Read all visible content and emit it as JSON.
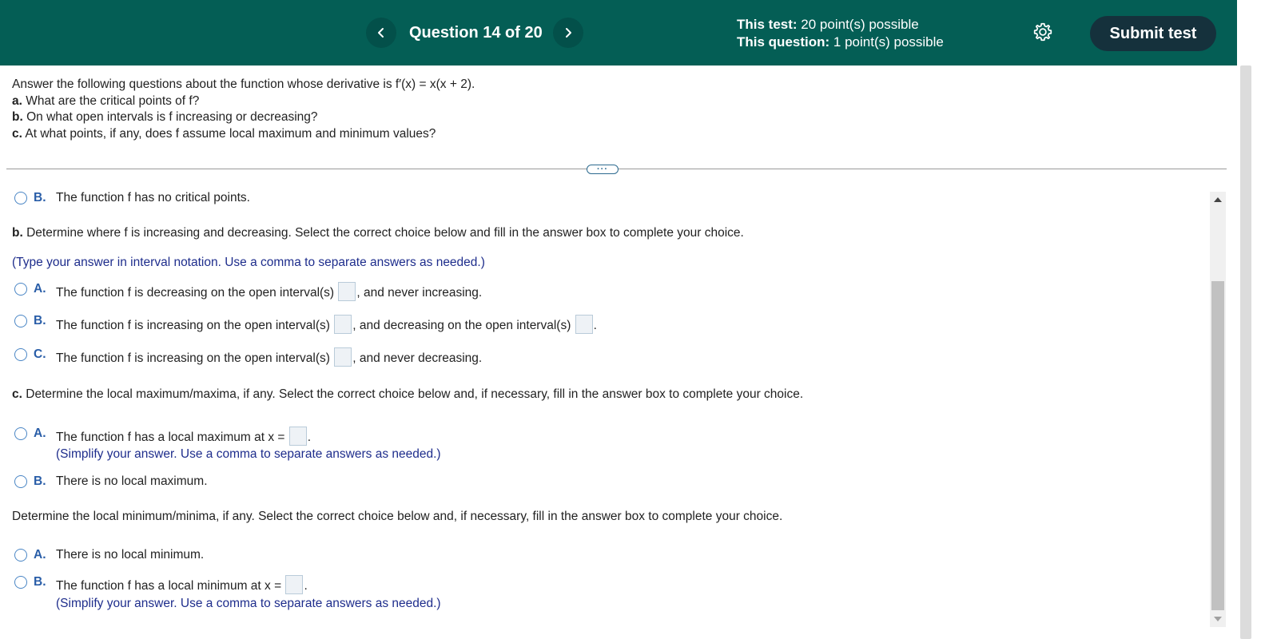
{
  "header": {
    "question_label": "Question 14 of 20",
    "test_points_label": "This test:",
    "test_points_value": "20 point(s) possible",
    "question_points_label": "This question:",
    "question_points_value": "1 point(s) possible",
    "submit_label": "Submit test",
    "background_color": "#045e55"
  },
  "prompt": {
    "line0": "Answer the following questions about the function whose derivative is f′(x) = x(x + 2).",
    "a_prefix": "a.",
    "a_text": " What are the critical points of f?",
    "b_prefix": "b.",
    "b_text": " On what open intervals is f increasing or decreasing?",
    "c_prefix": "c.",
    "c_text": " At what points, if any, does f assume local maximum and minimum values?"
  },
  "expand_button": "···",
  "part_a": {
    "option_b_letter": "B.",
    "option_b_text": "The function f has no critical points."
  },
  "part_b": {
    "prefix": "b.",
    "instruction": " Determine where f is increasing and decreasing. Select the correct choice below and fill in the answer box to complete your choice.",
    "hint": "(Type your answer in interval notation. Use a comma to separate answers as needed.)",
    "option_a_letter": "A.",
    "option_a_pre": "The function f is decreasing on the open interval(s) ",
    "option_a_post": ", and never increasing.",
    "option_b_letter": "B.",
    "option_b_pre": "The function f is increasing on the open interval(s) ",
    "option_b_mid": ", and decreasing on the open interval(s) ",
    "option_b_post": ".",
    "option_c_letter": "C.",
    "option_c_pre": "The function f is increasing on the open interval(s) ",
    "option_c_post": ", and never decreasing."
  },
  "part_c": {
    "prefix": "c.",
    "instruction": " Determine the local maximum/maxima, if any. Select the correct choice below and, if necessary, fill in the answer box to complete your choice.",
    "max_a_letter": "A.",
    "max_a_pre": "The function f has a local maximum at x = ",
    "max_a_post": ".",
    "max_a_hint": "(Simplify your answer. Use a comma to separate answers as needed.)",
    "max_b_letter": "B.",
    "max_b_text": "There is no local maximum.",
    "min_instruction": "Determine the local minimum/minima, if any. Select the correct choice below and, if necessary, fill in the answer box to complete your choice.",
    "min_a_letter": "A.",
    "min_a_text": "There is no local minimum.",
    "min_b_letter": "B.",
    "min_b_pre": "The function f has a local minimum at x = ",
    "min_b_post": ".",
    "min_b_hint": "(Simplify your answer. Use a comma to separate answers as needed.)"
  }
}
